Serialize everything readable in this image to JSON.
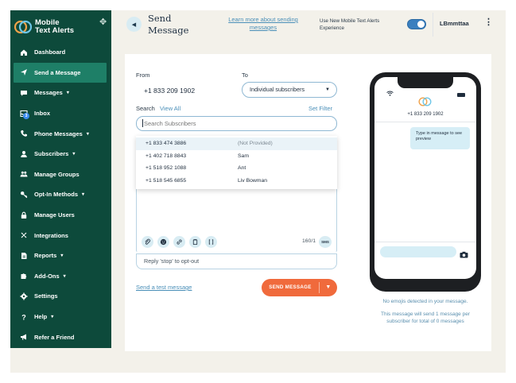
{
  "brand": {
    "line1": "Mobile",
    "line2": "Text Alerts"
  },
  "sidebar": {
    "items": [
      {
        "label": "Dashboard",
        "icon": "home-icon",
        "caret": ""
      },
      {
        "label": "Send a Message",
        "icon": "send-icon",
        "caret": "",
        "active": true
      },
      {
        "label": "Messages",
        "icon": "chat-icon",
        "caret": "▾"
      },
      {
        "label": "Inbox",
        "icon": "inbox-icon",
        "caret": "",
        "badge": "3"
      },
      {
        "label": "Phone Messages",
        "icon": "phone-icon",
        "caret": "▾"
      },
      {
        "label": "Subscribers",
        "icon": "user-icon",
        "caret": "▾"
      },
      {
        "label": "Manage Groups",
        "icon": "group-icon",
        "caret": ""
      },
      {
        "label": "Opt-In Methods",
        "icon": "key-icon",
        "caret": "▾"
      },
      {
        "label": "Manage Users",
        "icon": "lock-icon",
        "caret": ""
      },
      {
        "label": "Integrations",
        "icon": "integrations-icon",
        "caret": ""
      },
      {
        "label": "Reports",
        "icon": "report-icon",
        "caret": "▾"
      },
      {
        "label": "Add-Ons",
        "icon": "puzzle-icon",
        "caret": "▾"
      },
      {
        "label": "Settings",
        "icon": "gear-icon",
        "caret": ""
      },
      {
        "label": "Help",
        "icon": "help-icon",
        "caret": "▾"
      },
      {
        "label": "Refer a Friend",
        "icon": "megaphone-icon",
        "caret": ""
      }
    ]
  },
  "header": {
    "title": "Send Message",
    "learn_link": "Learn more about sending messages",
    "toggle_label": "Use New Mobile Text Alerts Experience",
    "toggle_on": true,
    "username": "LBmmttaa"
  },
  "form": {
    "from_label": "From",
    "from_value": "+1 833 209 1902",
    "to_label": "To",
    "to_value": "Individual subscribers",
    "search_label": "Search",
    "view_all": "View All",
    "set_filter": "Set Filter",
    "search_placeholder": "Search Subscribers",
    "subscribers": [
      {
        "phone": "+1 833 474 3886",
        "name": "(Not Provided)"
      },
      {
        "phone": "+1 402 718 8843",
        "name": "Sam"
      },
      {
        "phone": "+1 518 952 1088",
        "name": "Ant"
      },
      {
        "phone": "+1 518 545 6855",
        "name": "Liv Bowman"
      }
    ],
    "char_counter": "160/1",
    "sms_badge": "SMS",
    "optout_text": "Reply 'stop' to opt-out",
    "test_link": "Send a test message",
    "send_button": "SEND MESSAGE"
  },
  "preview": {
    "phone_number": "+1 833 209 1902",
    "bubble_text": "Type in message to see preview",
    "note_emojis": "No emojis detected in your message.",
    "note_count": "This message will send 1 message per subscriber for total of 0 messages"
  },
  "colors": {
    "sidebar_bg": "#0d4a3b",
    "sidebar_active": "#1e7f67",
    "accent_blue": "#4a8fb8",
    "send_orange": "#f06a3c"
  }
}
